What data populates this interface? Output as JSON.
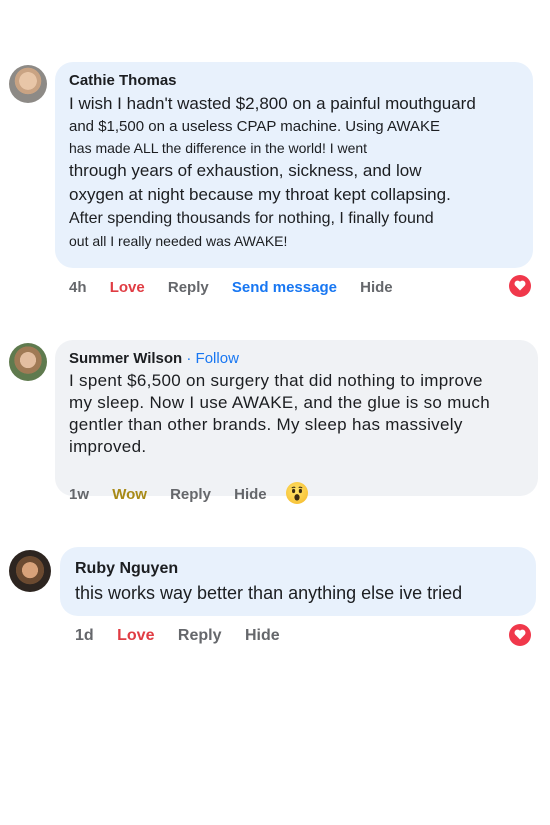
{
  "comments": [
    {
      "name": "Cathie Thomas",
      "lines": [
        "I wish I hadn't wasted $2,800 on a painful mouthguard",
        "and $1,500 on a useless CPAP machine. Using AWAKE",
        "has made ALL the difference in the world! I went",
        "through years of exhaustion, sickness, and low",
        "oxygen at night because my throat kept collapsing.",
        "After spending thousands for nothing, I finally found",
        "out all I really needed was AWAKE!"
      ],
      "time": "4h",
      "reaction_label": "Love",
      "reply": "Reply",
      "send_message": "Send message",
      "hide": "Hide",
      "reaction_icon": "love-heart-icon"
    },
    {
      "name": "Summer Wilson",
      "follow": "· Follow",
      "lines": [
        "I spent $6,500 on surgery that did nothing to improve",
        "my sleep. Now I use AWAKE, and the glue is so much",
        "gentler than other brands. My sleep has massively",
        "improved."
      ],
      "time": "1w",
      "reaction_label": "Wow",
      "reply": "Reply",
      "hide": "Hide",
      "reaction_icon": "wow-face-icon"
    },
    {
      "name": "Ruby Nguyen",
      "lines": [
        "this works way better than anything else ive tried"
      ],
      "time": "1d",
      "reaction_label": "Love",
      "reply": "Reply",
      "hide": "Hide",
      "reaction_icon": "love-heart-icon"
    }
  ],
  "colors": {
    "bubble": "#e8f1fc",
    "bubble_gray": "#f0f2f5",
    "love": "#e03c43",
    "wow": "#a88a17",
    "link": "#1877f2"
  }
}
